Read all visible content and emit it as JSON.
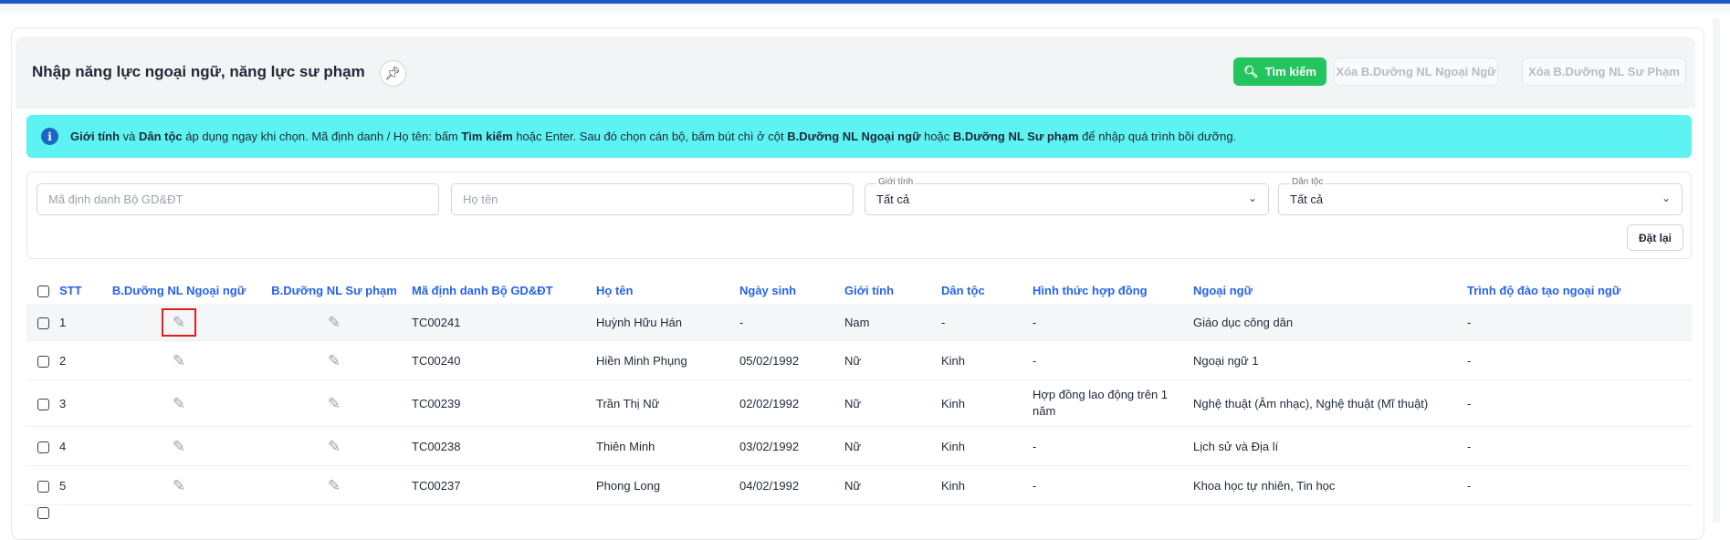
{
  "page": {
    "title": "Nhập năng lực ngoại ngữ, năng lực sư phạm",
    "pin_icon": "pin-icon",
    "search_button": "Tìm kiếm",
    "clear_foreign_button": "Xóa B.Dưỡng NL Ngoại Ngữ",
    "clear_pedagogy_button": "Xóa B.Dưỡng NL Sư Phạm"
  },
  "info": {
    "p1_b": "Giới tính",
    "p2": " và ",
    "p3_b": "Dân tộc",
    "p4": " áp dụng ngay khi chọn. Mã định danh / Họ tên: bấm ",
    "p5_b": "Tìm kiếm",
    "p6": " hoặc Enter. Sau đó chọn cán bộ, bấm bút chì ở cột ",
    "p7_b": "B.Dưỡng NL Ngoại ngữ",
    "p8": " hoặc ",
    "p9_b": "B.Dưỡng NL Sư phạm",
    "p10": " để nhập quá trình bồi dưỡng."
  },
  "filters": {
    "id_placeholder": "Mã định danh Bộ GD&ĐT",
    "name_placeholder": "Họ tên",
    "gender_label": "Giới tính",
    "gender_value": "Tất cả",
    "ethnic_label": "Dân tộc",
    "ethnic_value": "Tất cả",
    "reset_button": "Đặt lại"
  },
  "table": {
    "columns": [
      "STT",
      "B.Dưỡng NL Ngoại ngữ",
      "B.Dưỡng NL Sư phạm",
      "Mã định danh Bộ GD&ĐT",
      "Họ tên",
      "Ngày sinh",
      "Giới tính",
      "Dân tộc",
      "Hình thức hợp đồng",
      "Ngoại ngữ",
      "Trình độ đào tạo ngoại ngữ"
    ],
    "rows": [
      {
        "stt": "1",
        "id": "TC00241",
        "name": "Huỳnh Hữu Hán",
        "dob": "-",
        "gender": "Nam",
        "ethnic": "-",
        "contract": "-",
        "language": "Giáo dục công dân",
        "level": "-"
      },
      {
        "stt": "2",
        "id": "TC00240",
        "name": "Hiền Minh Phụng",
        "dob": "05/02/1992",
        "gender": "Nữ",
        "ethnic": "Kinh",
        "contract": "-",
        "language": "Ngoại ngữ 1",
        "level": "-"
      },
      {
        "stt": "3",
        "id": "TC00239",
        "name": "Trần Thị Nữ",
        "dob": "02/02/1992",
        "gender": "Nữ",
        "ethnic": "Kinh",
        "contract": "Hợp đồng lao động trên 1 năm",
        "language": "Nghệ thuật (Âm nhạc), Nghệ thuật (Mĩ thuật)",
        "level": "-"
      },
      {
        "stt": "4",
        "id": "TC00238",
        "name": "Thiên Minh",
        "dob": "03/02/1992",
        "gender": "Nữ",
        "ethnic": "Kinh",
        "contract": "-",
        "language": "Lịch sử và Địa lí",
        "level": "-"
      },
      {
        "stt": "5",
        "id": "TC00237",
        "name": "Phong Long",
        "dob": "04/02/1992",
        "gender": "Nữ",
        "ethnic": "Kinh",
        "contract": "-",
        "language": "Khoa học tự nhiên, Tin học",
        "level": "-"
      }
    ]
  }
}
